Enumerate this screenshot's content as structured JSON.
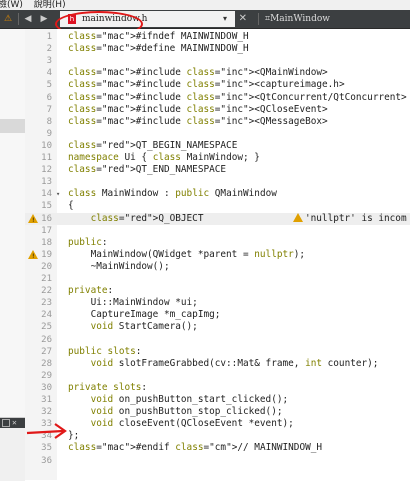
{
  "menubar": {
    "items": [
      "檢(W)",
      "說明(H)"
    ]
  },
  "tabbar": {
    "file_name": "mainwindow.h",
    "dropdown": "▾",
    "close": "✕",
    "symbol": "⌗MainWindow",
    "back": "◀",
    "forward": "▶"
  },
  "warning_text": "'nullptr' is incom",
  "lines": [
    {
      "n": "1",
      "t": "#ifndef MAINWINDOW_H"
    },
    {
      "n": "2",
      "t": "#define MAINWINDOW_H"
    },
    {
      "n": "3",
      "t": ""
    },
    {
      "n": "4",
      "t": "#include <QMainWindow>"
    },
    {
      "n": "5",
      "t": "#include <captureimage.h>"
    },
    {
      "n": "6",
      "t": "#include <QtConcurrent/QtConcurrent>"
    },
    {
      "n": "7",
      "t": "#include <QCloseEvent>"
    },
    {
      "n": "8",
      "t": "#include <QMessageBox>"
    },
    {
      "n": "9",
      "t": ""
    },
    {
      "n": "10",
      "t": "QT_BEGIN_NAMESPACE"
    },
    {
      "n": "11",
      "t": "namespace Ui { class MainWindow; }"
    },
    {
      "n": "12",
      "t": "QT_END_NAMESPACE"
    },
    {
      "n": "13",
      "t": ""
    },
    {
      "n": "14",
      "t": "class MainWindow : public QMainWindow"
    },
    {
      "n": "15",
      "t": "{"
    },
    {
      "n": "16",
      "t": "    Q_OBJECT"
    },
    {
      "n": "17",
      "t": ""
    },
    {
      "n": "18",
      "t": "public:"
    },
    {
      "n": "19",
      "t": "    MainWindow(QWidget *parent = nullptr);"
    },
    {
      "n": "20",
      "t": "    ~MainWindow();"
    },
    {
      "n": "21",
      "t": ""
    },
    {
      "n": "22",
      "t": "private:"
    },
    {
      "n": "23",
      "t": "    Ui::MainWindow *ui;"
    },
    {
      "n": "24",
      "t": "    CaptureImage *m_capImg;"
    },
    {
      "n": "25",
      "t": "    void StartCamera();"
    },
    {
      "n": "26",
      "t": ""
    },
    {
      "n": "27",
      "t": "public slots:"
    },
    {
      "n": "28",
      "t": "    void slotFrameGrabbed(cv::Mat& frame, int counter);"
    },
    {
      "n": "29",
      "t": ""
    },
    {
      "n": "30",
      "t": "private slots:"
    },
    {
      "n": "31",
      "t": "    void on_pushButton_start_clicked();"
    },
    {
      "n": "32",
      "t": "    void on_pushButton_stop_clicked();"
    },
    {
      "n": "33",
      "t": "    void closeEvent(QCloseEvent *event);"
    },
    {
      "n": "34",
      "t": "};"
    },
    {
      "n": "35",
      "t": "#endif // MAINWINDOW_H"
    },
    {
      "n": "36",
      "t": ""
    }
  ],
  "colors": {
    "accent_red": "#e01818",
    "warning": "#e0a000"
  }
}
